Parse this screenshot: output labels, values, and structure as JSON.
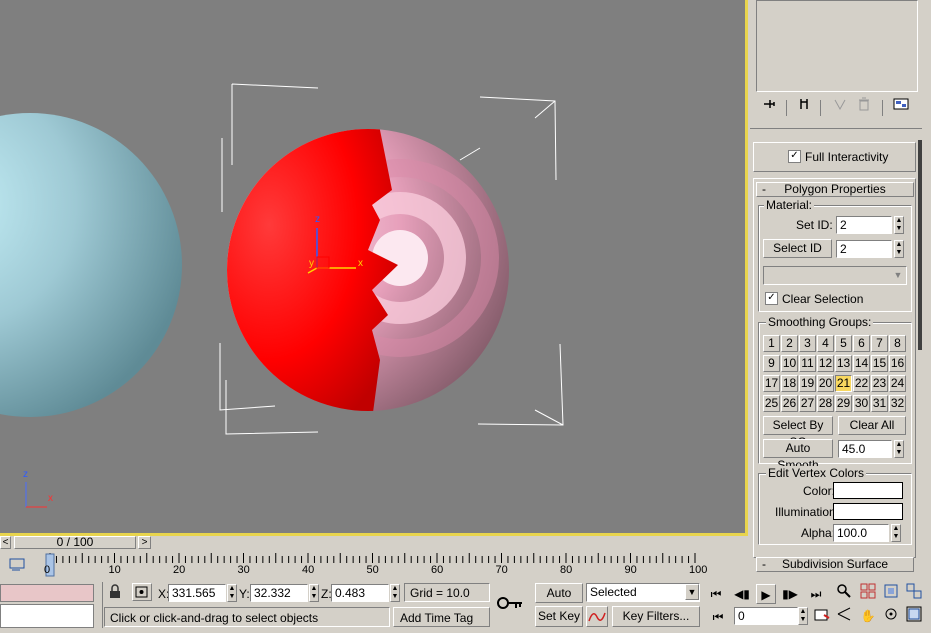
{
  "viewport": {
    "axes": {
      "x": "x",
      "y": "y",
      "z": "z"
    },
    "triad": {
      "x": "x",
      "z": "z"
    },
    "colors": {
      "bg": "#7f7f7f",
      "border": "#e8d44d",
      "sphere_left": "#9ec9d4",
      "sphere_red": "#ff0000",
      "sphere_pink": "#e7a0bb"
    }
  },
  "panel": {
    "toolbar_icons": [
      "pin-stack-icon",
      "show-end-result-icon",
      "make-unique-icon",
      "remove-modifier-icon",
      "configure-sets-icon"
    ],
    "full_interactivity": {
      "label": "Full Interactivity",
      "checked": true
    },
    "rollout_title": "Polygon Properties",
    "rollout_collapse": "-",
    "material": {
      "group": "Material:",
      "set_id_label": "Set ID:",
      "set_id_value": "2",
      "select_id_label": "Select ID",
      "select_id_value": "2",
      "clear_selection": "Clear Selection"
    },
    "smoothing": {
      "group": "Smoothing Groups:",
      "buttons": [
        "1",
        "2",
        "3",
        "4",
        "5",
        "6",
        "7",
        "8",
        "9",
        "10",
        "11",
        "12",
        "13",
        "14",
        "15",
        "16",
        "17",
        "18",
        "19",
        "20",
        "21",
        "22",
        "23",
        "24",
        "25",
        "26",
        "27",
        "28",
        "29",
        "30",
        "31",
        "32"
      ],
      "active": "21",
      "select_by_sg": "Select By SG",
      "clear_all": "Clear All",
      "auto_smooth_label": "Auto Smooth",
      "auto_smooth_value": "45.0"
    },
    "vertex_colors": {
      "group": "Edit Vertex Colors",
      "color_label": "Color:",
      "illumination_label": "Illumination:",
      "alpha_label": "Alpha:",
      "alpha_value": "100.0"
    },
    "next_rollout": "Subdivision Surface",
    "next_rollout_collapse": "-"
  },
  "timeline": {
    "frame_display": "0 / 100",
    "ticks": [
      "0",
      "10",
      "20",
      "30",
      "40",
      "50",
      "60",
      "70",
      "80",
      "90",
      "100"
    ]
  },
  "status": {
    "x_label": "X:",
    "x_value": "331.565",
    "y_label": "Y:",
    "y_value": "32.332",
    "z_label": "Z:",
    "z_value": "0.483",
    "grid": "Grid = 10.0",
    "prompt": "Click or click-and-drag to select objects",
    "add_time_tag": "Add Time Tag",
    "auto_key": "Auto Key",
    "set_key": "Set Key",
    "selected": "Selected",
    "key_filters": "Key Filters...",
    "frame_value": "0"
  }
}
